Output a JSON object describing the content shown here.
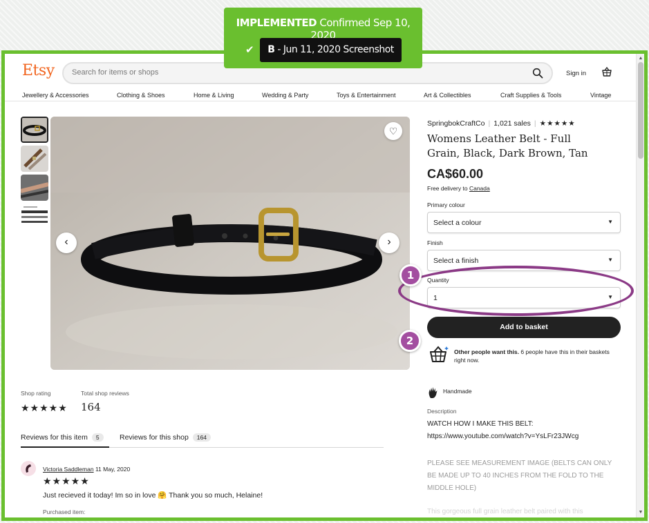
{
  "annotation": {
    "status": "IMPLEMENTED",
    "confirmed": "Confirmed Sep 10, 2020",
    "variant": "B",
    "screenshot_label": "- Jun 11, 2020 Screenshot",
    "markers": [
      "1",
      "2"
    ]
  },
  "header": {
    "logo": "Etsy",
    "search_placeholder": "Search for items or shops",
    "sign_in": "Sign in"
  },
  "nav": [
    "Jewellery & Accessories",
    "Clothing & Shoes",
    "Home & Living",
    "Wedding & Party",
    "Toys & Entertainment",
    "Art & Collectibles",
    "Craft Supplies & Tools",
    "Vintage"
  ],
  "listing": {
    "shop_name": "SpringbokCraftCo",
    "sales": "1,021 sales",
    "shop_stars": "★★★★★",
    "title": "Womens Leather Belt - Full Grain, Black, Dark Brown, Tan",
    "price": "CA$60.00",
    "delivery_prefix": "Free delivery to",
    "delivery_country": "Canada",
    "primary_colour_label": "Primary colour",
    "primary_colour_value": "Select a colour",
    "finish_label": "Finish",
    "finish_value": "Select a finish",
    "quantity_label": "Quantity",
    "quantity_value": "1",
    "add_to_basket": "Add to basket",
    "demand_bold": "Other people want this.",
    "demand_rest": " 6 people have this in their baskets right now.",
    "handmade": "Handmade",
    "description_label": "Description",
    "description_line1": "WATCH HOW I MAKE THIS BELT:",
    "description_line2": "https://www.youtube.com/watch?v=YsLFr23JWcg",
    "description_note": "PLEASE SEE MEASUREMENT IMAGE (BELTS CAN ONLY BE MADE UP TO 40 INCHES FROM THE FOLD TO THE MIDDLE HOLE)",
    "description_more": "This gorgeous full grain leather belt paired with this"
  },
  "reviews": {
    "shop_rating_label": "Shop rating",
    "shop_rating_stars": "★★★★★",
    "total_reviews_label": "Total shop reviews",
    "total_reviews": "164",
    "tab_item": "Reviews for this item",
    "tab_item_count": "5",
    "tab_shop": "Reviews for this shop",
    "tab_shop_count": "164",
    "reviewer_name": "Victoria Saddleman",
    "review_date": "11 May, 2020",
    "review_stars": "★★★★★",
    "review_text": "Just recieved it today! Im so in love 🤗 Thank you so much, Helaine!",
    "purchased_label": "Purchased item:"
  },
  "icons": {
    "search": "search-icon",
    "basket": "basket-icon",
    "heart": "heart-icon",
    "prev": "chevron-left-icon",
    "next": "chevron-right-icon",
    "demand": "shopping-basket-icon",
    "handmade": "hand-icon",
    "check": "check-icon"
  },
  "colors": {
    "annotation_green": "#6abf2f",
    "marker_purple": "#a34ea0",
    "etsy_orange": "#f1641e"
  }
}
